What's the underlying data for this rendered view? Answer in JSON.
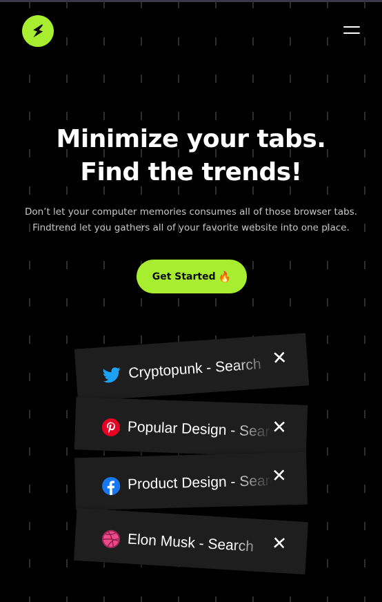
{
  "header": {
    "logo_icon": "lightning-bolt-icon",
    "menu_icon": "hamburger-menu-icon",
    "accent_color": "#a6ee2f"
  },
  "hero": {
    "title_line1": "Minimize your tabs.",
    "title_line2": "Find the trends!",
    "subtitle_line1": "Don’t let your computer memories consumes all of those browser tabs.",
    "subtitle_line2": "Findtrend let you gathers all of your favorite website into one place.",
    "cta_label": "Get Started",
    "cta_emoji": "🔥"
  },
  "tabs": [
    {
      "label": "Cryptopunk - Search",
      "icon": "twitter-icon",
      "close": "✕"
    },
    {
      "label": "Popular Design - Search",
      "icon": "pinterest-icon",
      "close": "✕"
    },
    {
      "label": "Product Design - Search",
      "icon": "facebook-icon",
      "close": "✕"
    },
    {
      "label": "Elon Musk - Search",
      "icon": "dribbble-icon",
      "close": "✕"
    }
  ]
}
